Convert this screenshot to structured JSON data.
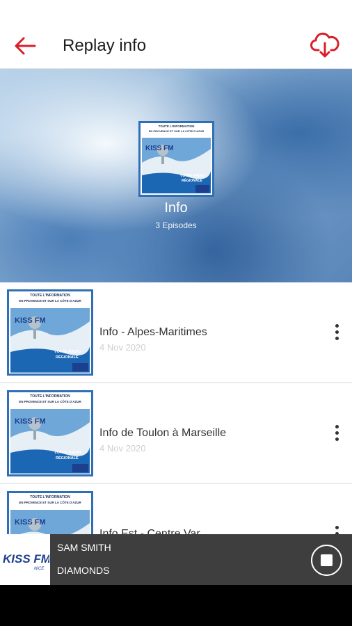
{
  "header": {
    "title": "Replay info",
    "back_icon": "arrow-left-icon",
    "download_icon": "cloud-download-icon",
    "accent_color": "#d81e2a"
  },
  "hero": {
    "podcast_name": "Info",
    "episode_count": "3 Episodes",
    "cover_headline_1": "TOUTE L'INFORMATION",
    "cover_headline_2": "EN PROVENCE ET SUR LA CÔTE D'AZUR",
    "cover_brand": "KISS FM",
    "cover_tagline_1": "VOTRE RADIO",
    "cover_tagline_2": "RÉGIONALE"
  },
  "episodes": [
    {
      "title": "Info - Alpes-Maritimes",
      "date": "4 Nov 2020"
    },
    {
      "title": "Info de Toulon à Marseille",
      "date": "4 Nov 2020"
    },
    {
      "title": "Info Est - Centre Var",
      "date": ""
    }
  ],
  "player": {
    "station_logo": "KISS FM",
    "station_city": "NICE",
    "artist": "SAM SMITH",
    "song": "DIAMONDS",
    "stop_icon": "stop-icon"
  }
}
